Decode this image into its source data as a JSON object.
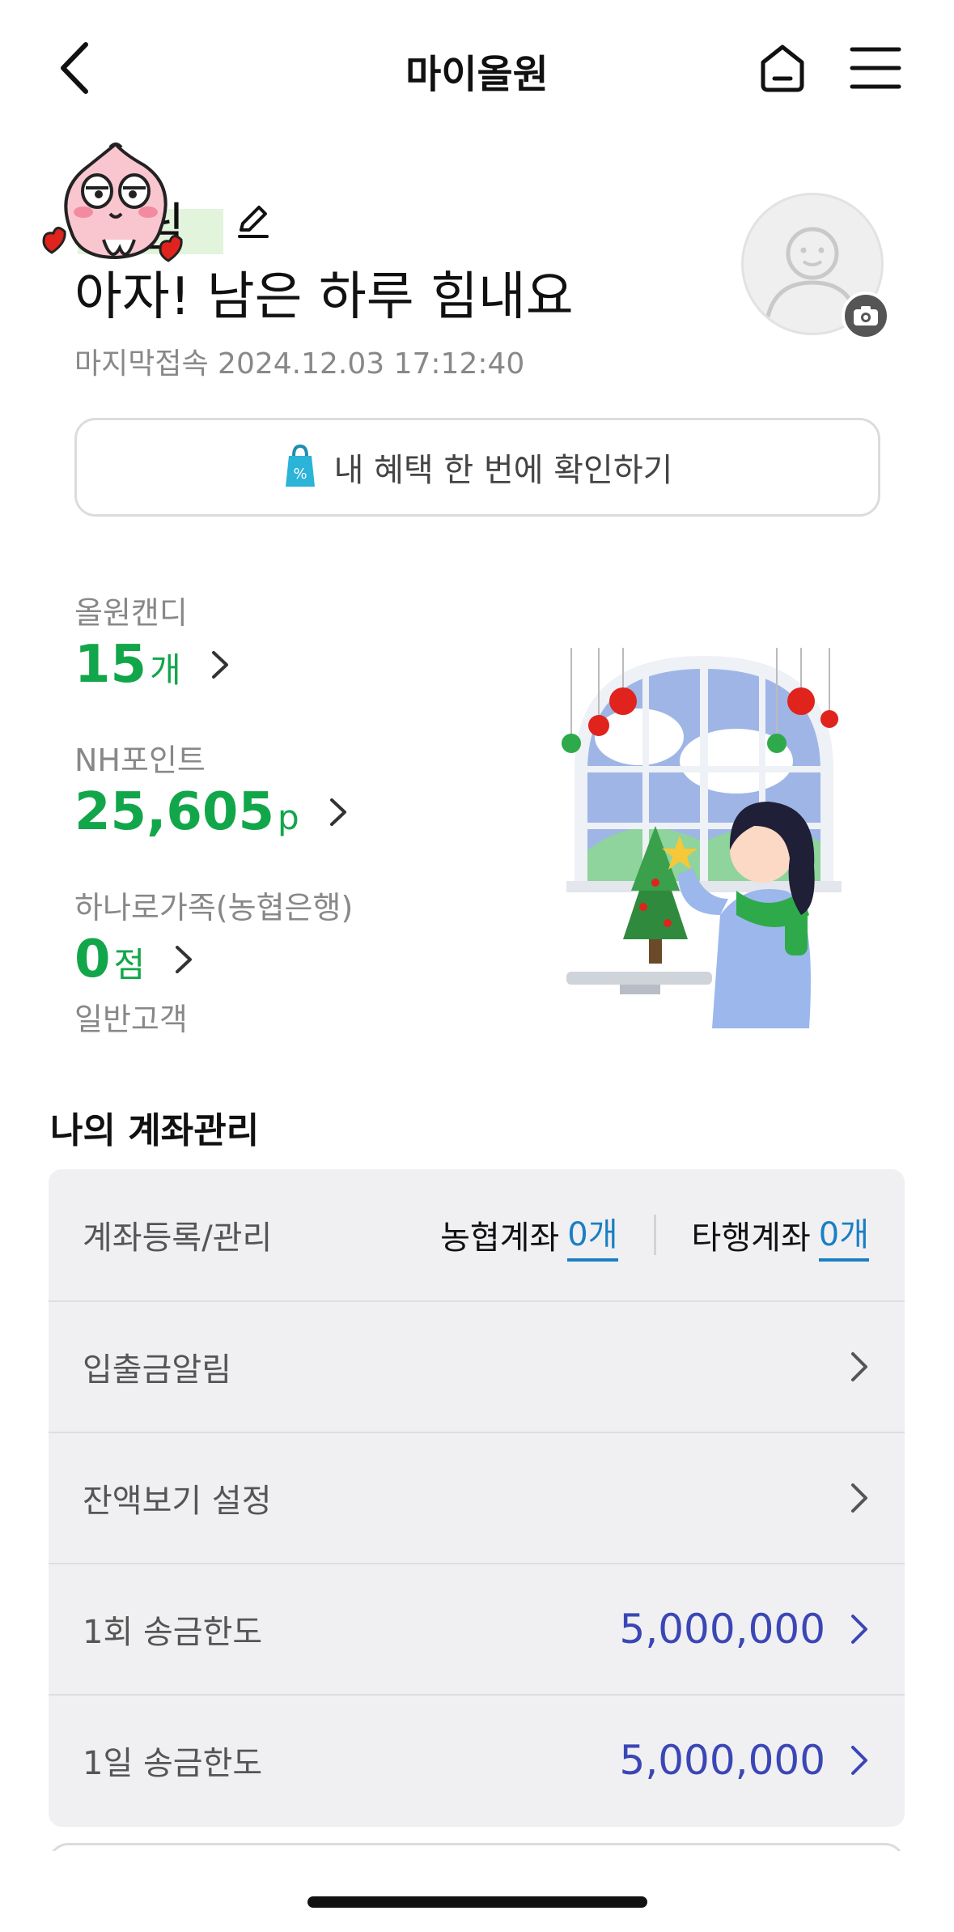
{
  "header": {
    "title": "마이올원",
    "back_icon": "chevron-left-icon",
    "home_icon": "home-icon",
    "menu_icon": "hamburger-menu-icon"
  },
  "profile": {
    "name_suffix": "님",
    "greeting": "아자! 남은 하루 힘내요",
    "last_login": "마지막접속 2024.12.03 17:12:40",
    "avatar_icon": "user-avatar-icon",
    "camera_icon": "camera-icon",
    "edit_icon": "pencil-icon"
  },
  "benefit_button": {
    "label": "내 혜택 한 번에 확인하기",
    "icon": "price-tag-icon"
  },
  "stats": {
    "candy": {
      "label": "올원캔디",
      "value": "15",
      "unit": "개"
    },
    "points": {
      "label": "NH포인트",
      "value": "25,605",
      "unit": "p"
    },
    "hanaro": {
      "label": "하나로가족(농협은행)",
      "value": "0",
      "unit": "점",
      "grade": "일반고객"
    }
  },
  "accounts": {
    "section_title": "나의 계좌관리",
    "register_label": "계좌등록/관리",
    "nh_label": "농협계좌",
    "nh_count": "0개",
    "other_label": "타행계좌",
    "other_count": "0개",
    "rows": [
      {
        "label": "입출금알림"
      },
      {
        "label": "잔액보기 설정"
      },
      {
        "label": "1회 송금한도",
        "amount": "5,000,000"
      },
      {
        "label": "1일 송금한도",
        "amount": "5,000,000"
      }
    ]
  },
  "colors": {
    "green": "#12a64a",
    "blue_amount": "#3b46b6",
    "link_blue": "#1a7fc4"
  }
}
